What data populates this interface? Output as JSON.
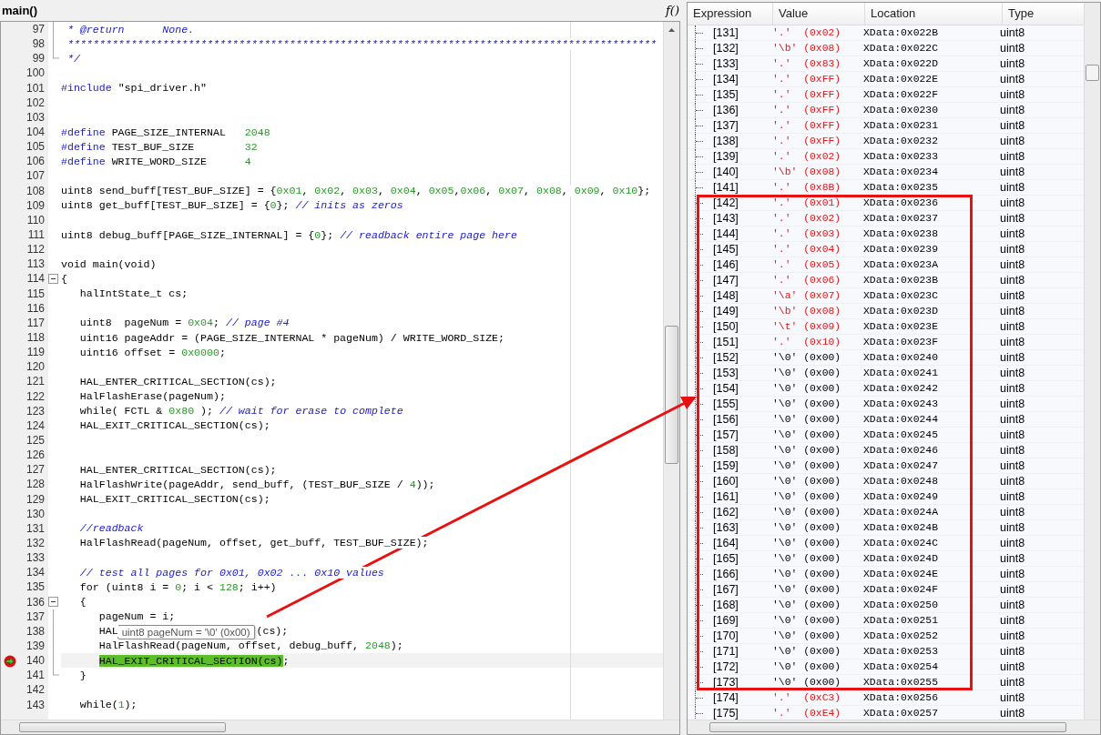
{
  "editor": {
    "function_name": "main()",
    "function_button": "f()",
    "lines": [
      {
        "n": "97",
        "fold": {
          "kind": "line"
        },
        "current": false,
        "tokens": [
          {
            "kind": "comment",
            "text": " * @return      None."
          }
        ]
      },
      {
        "n": "98",
        "fold": {
          "kind": "line"
        },
        "current": false,
        "tokens": [
          {
            "kind": "comment",
            "text": " *********************************************************************************************"
          }
        ]
      },
      {
        "n": "99",
        "fold": {
          "kind": "end"
        },
        "current": false,
        "tokens": [
          {
            "kind": "comment",
            "text": " */"
          }
        ]
      },
      {
        "n": "100",
        "current": false
      },
      {
        "n": "101",
        "current": false,
        "tokens": [
          {
            "kind": "directive",
            "text": "#include"
          },
          {
            "kind": "plain",
            "text": " \"spi_driver.h\""
          }
        ]
      },
      {
        "n": "102",
        "current": false
      },
      {
        "n": "103",
        "current": false
      },
      {
        "n": "104",
        "current": false,
        "tokens": [
          {
            "kind": "directive",
            "text": "#define"
          },
          {
            "kind": "plain",
            "text": " PAGE_SIZE_INTERNAL   "
          },
          {
            "kind": "number",
            "text": "2048"
          }
        ]
      },
      {
        "n": "105",
        "current": false,
        "tokens": [
          {
            "kind": "directive",
            "text": "#define"
          },
          {
            "kind": "plain",
            "text": " TEST_BUF_SIZE        "
          },
          {
            "kind": "number",
            "text": "32"
          }
        ]
      },
      {
        "n": "106",
        "current": false,
        "tokens": [
          {
            "kind": "directive",
            "text": "#define"
          },
          {
            "kind": "plain",
            "text": " WRITE_WORD_SIZE      "
          },
          {
            "kind": "number",
            "text": "4"
          }
        ]
      },
      {
        "n": "107",
        "current": false
      },
      {
        "n": "108",
        "current": false,
        "tokens": [
          {
            "kind": "plain",
            "text": "uint8 send_buff[TEST_BUF_SIZE] = {"
          },
          {
            "kind": "number",
            "text": "0x01"
          },
          {
            "kind": "plain",
            "text": ", "
          },
          {
            "kind": "number",
            "text": "0x02"
          },
          {
            "kind": "plain",
            "text": ", "
          },
          {
            "kind": "number",
            "text": "0x03"
          },
          {
            "kind": "plain",
            "text": ", "
          },
          {
            "kind": "number",
            "text": "0x04"
          },
          {
            "kind": "plain",
            "text": ", "
          },
          {
            "kind": "number",
            "text": "0x05"
          },
          {
            "kind": "plain",
            "text": ","
          },
          {
            "kind": "number",
            "text": "0x06"
          },
          {
            "kind": "plain",
            "text": ", "
          },
          {
            "kind": "number",
            "text": "0x07"
          },
          {
            "kind": "plain",
            "text": ", "
          },
          {
            "kind": "number",
            "text": "0x08"
          },
          {
            "kind": "plain",
            "text": ", "
          },
          {
            "kind": "number",
            "text": "0x09"
          },
          {
            "kind": "plain",
            "text": ", "
          },
          {
            "kind": "number",
            "text": "0x10"
          },
          {
            "kind": "plain",
            "text": "};"
          }
        ]
      },
      {
        "n": "109",
        "current": false,
        "tokens": [
          {
            "kind": "plain",
            "text": "uint8 get_buff[TEST_BUF_SIZE] = {"
          },
          {
            "kind": "number",
            "text": "0"
          },
          {
            "kind": "plain",
            "text": "}; "
          },
          {
            "kind": "comment",
            "text": "// inits as zeros"
          }
        ]
      },
      {
        "n": "110",
        "current": false
      },
      {
        "n": "111",
        "current": false,
        "tokens": [
          {
            "kind": "plain",
            "text": "uint8 debug_buff[PAGE_SIZE_INTERNAL] = {"
          },
          {
            "kind": "number",
            "text": "0"
          },
          {
            "kind": "plain",
            "text": "}; "
          },
          {
            "kind": "comment",
            "text": "// readback entire page here"
          }
        ]
      },
      {
        "n": "112",
        "current": false
      },
      {
        "n": "113",
        "current": false,
        "tokens": [
          {
            "kind": "plain",
            "text": "void main(void)"
          }
        ]
      },
      {
        "n": "114",
        "fold": {
          "kind": "open"
        },
        "current": false,
        "tokens": [
          {
            "kind": "plain",
            "text": "{"
          }
        ]
      },
      {
        "n": "115",
        "current": false,
        "tokens": [
          {
            "kind": "plain",
            "text": "   halIntState_t cs;"
          }
        ]
      },
      {
        "n": "116",
        "current": false
      },
      {
        "n": "117",
        "current": false,
        "tokens": [
          {
            "kind": "plain",
            "text": "   uint8  pageNum = "
          },
          {
            "kind": "number",
            "text": "0x04"
          },
          {
            "kind": "plain",
            "text": "; "
          },
          {
            "kind": "comment",
            "text": "// page #4"
          }
        ]
      },
      {
        "n": "118",
        "current": false,
        "tokens": [
          {
            "kind": "plain",
            "text": "   uint16 pageAddr = (PAGE_SIZE_INTERNAL * pageNum) / WRITE_WORD_SIZE;"
          }
        ]
      },
      {
        "n": "119",
        "current": false,
        "tokens": [
          {
            "kind": "plain",
            "text": "   uint16 offset = "
          },
          {
            "kind": "number",
            "text": "0x0000"
          },
          {
            "kind": "plain",
            "text": ";"
          }
        ]
      },
      {
        "n": "120",
        "current": false
      },
      {
        "n": "121",
        "current": false,
        "tokens": [
          {
            "kind": "plain",
            "text": "   HAL_ENTER_CRITICAL_SECTION(cs);"
          }
        ]
      },
      {
        "n": "122",
        "current": false,
        "tokens": [
          {
            "kind": "plain",
            "text": "   HalFlashErase(pageNum);"
          }
        ]
      },
      {
        "n": "123",
        "current": false,
        "tokens": [
          {
            "kind": "plain",
            "text": "   while( FCTL & "
          },
          {
            "kind": "number",
            "text": "0x80"
          },
          {
            "kind": "plain",
            "text": " ); "
          },
          {
            "kind": "comment",
            "text": "// wait for erase to complete"
          }
        ]
      },
      {
        "n": "124",
        "current": false,
        "tokens": [
          {
            "kind": "plain",
            "text": "   HAL_EXIT_CRITICAL_SECTION(cs);"
          }
        ]
      },
      {
        "n": "125",
        "current": false
      },
      {
        "n": "126",
        "current": false
      },
      {
        "n": "127",
        "current": false,
        "tokens": [
          {
            "kind": "plain",
            "text": "   HAL_ENTER_CRITICAL_SECTION(cs);"
          }
        ]
      },
      {
        "n": "128",
        "current": false,
        "tokens": [
          {
            "kind": "plain",
            "text": "   HalFlashWrite(pageAddr, send_buff, (TEST_BUF_SIZE / "
          },
          {
            "kind": "number",
            "text": "4"
          },
          {
            "kind": "plain",
            "text": "));"
          }
        ]
      },
      {
        "n": "129",
        "current": false,
        "tokens": [
          {
            "kind": "plain",
            "text": "   HAL_EXIT_CRITICAL_SECTION(cs);"
          }
        ]
      },
      {
        "n": "130",
        "current": false
      },
      {
        "n": "131",
        "current": false,
        "tokens": [
          {
            "kind": "comment",
            "text": "   //readback"
          }
        ]
      },
      {
        "n": "132",
        "current": false,
        "tokens": [
          {
            "kind": "plain",
            "text": "   HalFlashRead(pageNum, offset, get_buff, TEST_BUF_SIZE);"
          }
        ]
      },
      {
        "n": "133",
        "current": false
      },
      {
        "n": "134",
        "current": false,
        "tokens": [
          {
            "kind": "comment",
            "text": "   // test all pages for 0x01, 0x02 ... 0x10 values"
          }
        ]
      },
      {
        "n": "135",
        "current": false,
        "tokens": [
          {
            "kind": "plain",
            "text": "   for (uint8 i = "
          },
          {
            "kind": "number",
            "text": "0"
          },
          {
            "kind": "plain",
            "text": "; i < "
          },
          {
            "kind": "number",
            "text": "128"
          },
          {
            "kind": "plain",
            "text": "; i++)"
          }
        ]
      },
      {
        "n": "136",
        "fold": {
          "kind": "open"
        },
        "current": false,
        "tokens": [
          {
            "kind": "plain",
            "text": "   {"
          }
        ]
      },
      {
        "n": "137",
        "fold": {
          "kind": "line"
        },
        "current": false,
        "tokens": [
          {
            "kind": "plain",
            "text": "      pageNum = i;"
          }
        ]
      },
      {
        "n": "138",
        "fold": {
          "kind": "line"
        },
        "current": false,
        "tokens": [
          {
            "kind": "plain",
            "text": "      HAL"
          },
          {
            "kind": "plain",
            "text": "(cs);"
          }
        ],
        "tooltip": "uint8 pageNum = '\\0' (0x00)"
      },
      {
        "n": "139",
        "fold": {
          "kind": "line"
        },
        "current": false,
        "tokens": [
          {
            "kind": "plain",
            "text": "      HalFlashRead(pageNum, offset, debug_buff, "
          },
          {
            "kind": "number",
            "text": "2048"
          },
          {
            "kind": "plain",
            "text": ");"
          }
        ]
      },
      {
        "n": "140",
        "fold": {
          "kind": "line"
        },
        "current": true,
        "tokens": [
          {
            "kind": "highlight",
            "text": "HAL_EXIT_CRITICAL_SECTION(cs)"
          },
          {
            "kind": "plain",
            "text": ";"
          }
        ]
      },
      {
        "n": "141",
        "fold": {
          "kind": "end"
        },
        "current": false,
        "tokens": [
          {
            "kind": "plain",
            "text": "   }"
          }
        ]
      },
      {
        "n": "142",
        "current": false
      },
      {
        "n": "143",
        "current": false,
        "tokens": [
          {
            "kind": "plain",
            "text": "   while("
          },
          {
            "kind": "number",
            "text": "1"
          },
          {
            "kind": "plain",
            "text": ");"
          }
        ]
      }
    ]
  },
  "watch": {
    "columns": [
      "Expression",
      "Value",
      "Location",
      "Type"
    ],
    "rows": [
      {
        "expression": "[131]",
        "value": "'.'  (0x02)",
        "location": "XData:0x022B",
        "type": "uint8",
        "changed": true
      },
      {
        "expression": "[132]",
        "value": "'\\b' (0x08)",
        "location": "XData:0x022C",
        "type": "uint8",
        "changed": true
      },
      {
        "expression": "[133]",
        "value": "'.'  (0x83)",
        "location": "XData:0x022D",
        "type": "uint8",
        "changed": true
      },
      {
        "expression": "[134]",
        "value": "'.'  (0xFF)",
        "location": "XData:0x022E",
        "type": "uint8",
        "changed": true
      },
      {
        "expression": "[135]",
        "value": "'.'  (0xFF)",
        "location": "XData:0x022F",
        "type": "uint8",
        "changed": true
      },
      {
        "expression": "[136]",
        "value": "'.'  (0xFF)",
        "location": "XData:0x0230",
        "type": "uint8",
        "changed": true
      },
      {
        "expression": "[137]",
        "value": "'.'  (0xFF)",
        "location": "XData:0x0231",
        "type": "uint8",
        "changed": true
      },
      {
        "expression": "[138]",
        "value": "'.'  (0xFF)",
        "location": "XData:0x0232",
        "type": "uint8",
        "changed": true
      },
      {
        "expression": "[139]",
        "value": "'.'  (0x02)",
        "location": "XData:0x0233",
        "type": "uint8",
        "changed": true
      },
      {
        "expression": "[140]",
        "value": "'\\b' (0x08)",
        "location": "XData:0x0234",
        "type": "uint8",
        "changed": true
      },
      {
        "expression": "[141]",
        "value": "'.'  (0x8B)",
        "location": "XData:0x0235",
        "type": "uint8",
        "changed": true
      },
      {
        "expression": "[142]",
        "value": "'.'  (0x01)",
        "location": "XData:0x0236",
        "type": "uint8",
        "changed": true
      },
      {
        "expression": "[143]",
        "value": "'.'  (0x02)",
        "location": "XData:0x0237",
        "type": "uint8",
        "changed": true
      },
      {
        "expression": "[144]",
        "value": "'.'  (0x03)",
        "location": "XData:0x0238",
        "type": "uint8",
        "changed": true
      },
      {
        "expression": "[145]",
        "value": "'.'  (0x04)",
        "location": "XData:0x0239",
        "type": "uint8",
        "changed": true
      },
      {
        "expression": "[146]",
        "value": "'.'  (0x05)",
        "location": "XData:0x023A",
        "type": "uint8",
        "changed": true
      },
      {
        "expression": "[147]",
        "value": "'.'  (0x06)",
        "location": "XData:0x023B",
        "type": "uint8",
        "changed": true
      },
      {
        "expression": "[148]",
        "value": "'\\a' (0x07)",
        "location": "XData:0x023C",
        "type": "uint8",
        "changed": true
      },
      {
        "expression": "[149]",
        "value": "'\\b' (0x08)",
        "location": "XData:0x023D",
        "type": "uint8",
        "changed": true
      },
      {
        "expression": "[150]",
        "value": "'\\t' (0x09)",
        "location": "XData:0x023E",
        "type": "uint8",
        "changed": true
      },
      {
        "expression": "[151]",
        "value": "'.'  (0x10)",
        "location": "XData:0x023F",
        "type": "uint8",
        "changed": true
      },
      {
        "expression": "[152]",
        "value": "'\\0' (0x00)",
        "location": "XData:0x0240",
        "type": "uint8",
        "changed": false
      },
      {
        "expression": "[153]",
        "value": "'\\0' (0x00)",
        "location": "XData:0x0241",
        "type": "uint8",
        "changed": false
      },
      {
        "expression": "[154]",
        "value": "'\\0' (0x00)",
        "location": "XData:0x0242",
        "type": "uint8",
        "changed": false
      },
      {
        "expression": "[155]",
        "value": "'\\0' (0x00)",
        "location": "XData:0x0243",
        "type": "uint8",
        "changed": false
      },
      {
        "expression": "[156]",
        "value": "'\\0' (0x00)",
        "location": "XData:0x0244",
        "type": "uint8",
        "changed": false
      },
      {
        "expression": "[157]",
        "value": "'\\0' (0x00)",
        "location": "XData:0x0245",
        "type": "uint8",
        "changed": false
      },
      {
        "expression": "[158]",
        "value": "'\\0' (0x00)",
        "location": "XData:0x0246",
        "type": "uint8",
        "changed": false
      },
      {
        "expression": "[159]",
        "value": "'\\0' (0x00)",
        "location": "XData:0x0247",
        "type": "uint8",
        "changed": false
      },
      {
        "expression": "[160]",
        "value": "'\\0' (0x00)",
        "location": "XData:0x0248",
        "type": "uint8",
        "changed": false
      },
      {
        "expression": "[161]",
        "value": "'\\0' (0x00)",
        "location": "XData:0x0249",
        "type": "uint8",
        "changed": false
      },
      {
        "expression": "[162]",
        "value": "'\\0' (0x00)",
        "location": "XData:0x024A",
        "type": "uint8",
        "changed": false
      },
      {
        "expression": "[163]",
        "value": "'\\0' (0x00)",
        "location": "XData:0x024B",
        "type": "uint8",
        "changed": false
      },
      {
        "expression": "[164]",
        "value": "'\\0' (0x00)",
        "location": "XData:0x024C",
        "type": "uint8",
        "changed": false
      },
      {
        "expression": "[165]",
        "value": "'\\0' (0x00)",
        "location": "XData:0x024D",
        "type": "uint8",
        "changed": false
      },
      {
        "expression": "[166]",
        "value": "'\\0' (0x00)",
        "location": "XData:0x024E",
        "type": "uint8",
        "changed": false
      },
      {
        "expression": "[167]",
        "value": "'\\0' (0x00)",
        "location": "XData:0x024F",
        "type": "uint8",
        "changed": false
      },
      {
        "expression": "[168]",
        "value": "'\\0' (0x00)",
        "location": "XData:0x0250",
        "type": "uint8",
        "changed": false
      },
      {
        "expression": "[169]",
        "value": "'\\0' (0x00)",
        "location": "XData:0x0251",
        "type": "uint8",
        "changed": false
      },
      {
        "expression": "[170]",
        "value": "'\\0' (0x00)",
        "location": "XData:0x0252",
        "type": "uint8",
        "changed": false
      },
      {
        "expression": "[171]",
        "value": "'\\0' (0x00)",
        "location": "XData:0x0253",
        "type": "uint8",
        "changed": false
      },
      {
        "expression": "[172]",
        "value": "'\\0' (0x00)",
        "location": "XData:0x0254",
        "type": "uint8",
        "changed": false
      },
      {
        "expression": "[173]",
        "value": "'\\0' (0x00)",
        "location": "XData:0x0255",
        "type": "uint8",
        "changed": false
      },
      {
        "expression": "[174]",
        "value": "'.'  (0xC3)",
        "location": "XData:0x0256",
        "type": "uint8",
        "changed": true
      },
      {
        "expression": "[175]",
        "value": "'.'  (0xE4)",
        "location": "XData:0x0257",
        "type": "uint8",
        "changed": true
      }
    ]
  }
}
